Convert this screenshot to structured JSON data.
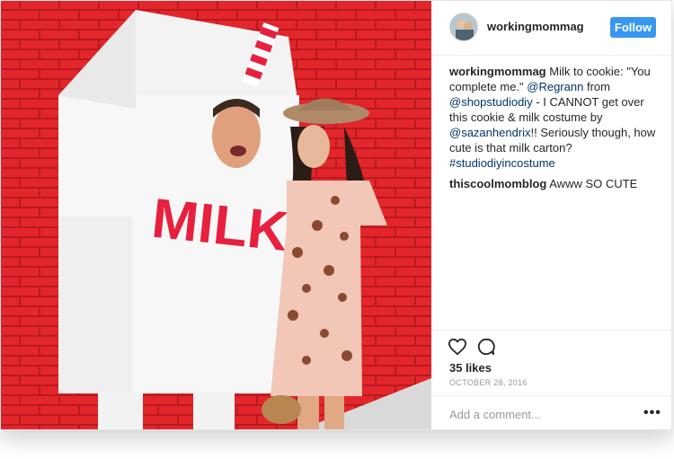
{
  "post": {
    "username": "workingmommag",
    "follow_label": "Follow",
    "caption": {
      "user": "workingmommag",
      "text_1": " Milk to cookie: \"You complete me.\" ",
      "mention_1": "@Regrann",
      "text_2": " from ",
      "mention_2": "@shopstudiodiy",
      "text_3": " - I CANNOT get over this cookie & milk costume by ",
      "mention_3": "@sazanhendrix",
      "text_4": "!! Seriously though, how cute is that milk carton? ",
      "hashtag": "#studiodiyincostume"
    },
    "comment": {
      "user": "thiscoolmomblog",
      "text": " Awww SO CUTE"
    },
    "likes": "35 likes",
    "date": "OCTOBER 28, 2016",
    "add_comment_placeholder": "Add a comment...",
    "more_label": "•••",
    "photo_text": "MILK"
  },
  "colors": {
    "accent": "#3897f0",
    "link": "#003569",
    "brick": "#e0282d",
    "milk_letters": "#e8203f"
  },
  "icons": [
    "heart-icon",
    "comment-icon",
    "more-options-icon"
  ]
}
